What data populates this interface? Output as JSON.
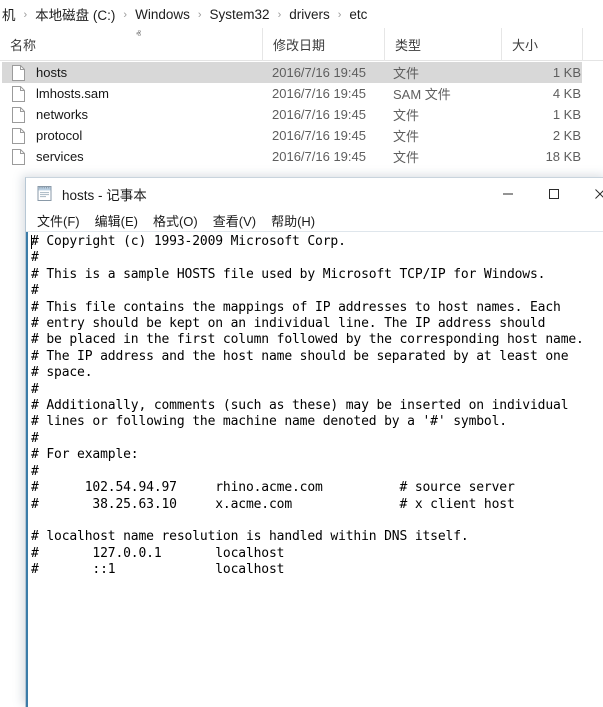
{
  "explorer": {
    "breadcrumb": {
      "separator": "›",
      "items": [
        "机",
        "本地磁盘 (C:)",
        "Windows",
        "System32",
        "drivers",
        "etc"
      ]
    },
    "columns": [
      {
        "label": "名称",
        "sort_indicator": "ⱏ"
      },
      {
        "label": "修改日期",
        "sort_indicator": ""
      },
      {
        "label": "类型",
        "sort_indicator": ""
      },
      {
        "label": "大小",
        "sort_indicator": ""
      }
    ],
    "files": [
      {
        "icon": "file-icon",
        "name": "hosts",
        "date": "2016/7/16 19:45",
        "type": "文件",
        "size": "1 KB",
        "selected": true
      },
      {
        "icon": "file-icon",
        "name": "lmhosts.sam",
        "date": "2016/7/16 19:45",
        "type": "SAM 文件",
        "size": "4 KB",
        "selected": false
      },
      {
        "icon": "file-icon",
        "name": "networks",
        "date": "2016/7/16 19:45",
        "type": "文件",
        "size": "1 KB",
        "selected": false
      },
      {
        "icon": "file-icon",
        "name": "protocol",
        "date": "2016/7/16 19:45",
        "type": "文件",
        "size": "2 KB",
        "selected": false
      },
      {
        "icon": "file-icon",
        "name": "services",
        "date": "2016/7/16 19:45",
        "type": "文件",
        "size": "18 KB",
        "selected": false
      }
    ]
  },
  "notepad": {
    "title": "hosts - 记事本",
    "app_icon": "notepad-icon",
    "window_controls": {
      "minimize": "—",
      "maximize": "☐",
      "close": "✕"
    },
    "menus": [
      "文件(F)",
      "编辑(E)",
      "格式(O)",
      "查看(V)",
      "帮助(H)"
    ],
    "content": "# Copyright (c) 1993-2009 Microsoft Corp.\n#\n# This is a sample HOSTS file used by Microsoft TCP/IP for Windows.\n#\n# This file contains the mappings of IP addresses to host names. Each\n# entry should be kept on an individual line. The IP address should\n# be placed in the first column followed by the corresponding host name.\n# The IP address and the host name should be separated by at least one\n# space.\n#\n# Additionally, comments (such as these) may be inserted on individual\n# lines or following the machine name denoted by a '#' symbol.\n#\n# For example:\n#\n#      102.54.94.97     rhino.acme.com          # source server\n#       38.25.63.10     x.acme.com              # x client host\n\n# localhost name resolution is handled within DNS itself.\n#       127.0.0.1       localhost\n#       ::1             localhost\n"
  },
  "colors": {
    "selection": "#d8d8d8",
    "notepad_border": "#3c7ca8",
    "breadcrumb_text": "#1b1b1b",
    "secondary_text": "#5e5e5e"
  }
}
